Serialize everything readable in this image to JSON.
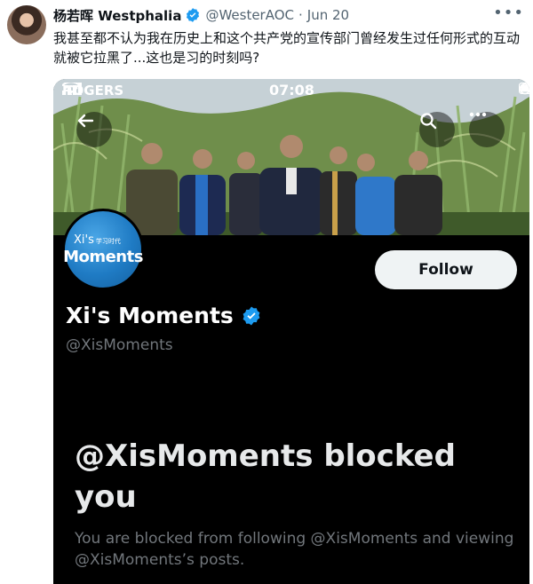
{
  "tweet": {
    "author_name": "杨若晖 Westphalia",
    "handle": "@WesterAOC",
    "separator": "·",
    "date": "Jun 20",
    "text": "我甚至都不认为我在历史上和这个共产党的宣传部门曾经发生过任何形式的互动就被它拉黑了...这也是习的时刻吗?",
    "more_icon": "more-horizontal-icon"
  },
  "screenshot": {
    "status_bar": {
      "carrier": "ROGERS",
      "time": "07:08"
    },
    "profile": {
      "avatar_logo_top": "Xi's",
      "avatar_logo_small": "学习时代",
      "avatar_logo_bottom": "Moments",
      "name": "Xi's Moments",
      "handle": "@XisMoments",
      "follow_label": "Follow"
    },
    "blocked": {
      "title": "@XisMoments blocked you",
      "description": "You are blocked from following @XisMoments and viewing @XisMoments’s posts."
    }
  },
  "colors": {
    "verified": "#1d9bf0",
    "dark_bg": "#000000",
    "muted": "#71767b",
    "follow_bg": "#eff3f4"
  }
}
